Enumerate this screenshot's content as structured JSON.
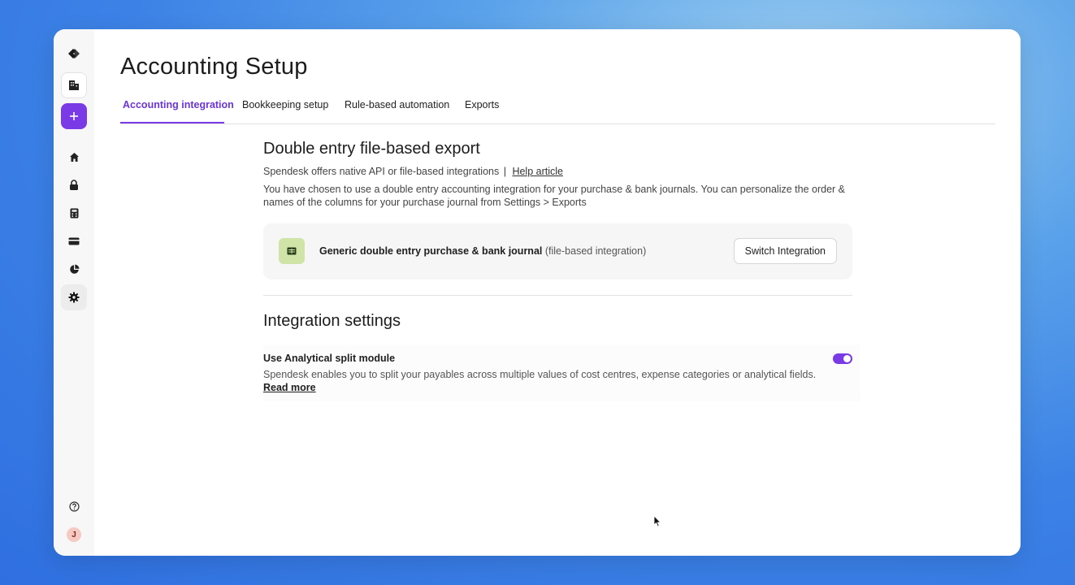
{
  "page": {
    "title": "Accounting Setup"
  },
  "sidebar": {
    "items": [
      {
        "name": "logo",
        "icon": "spendesk-logo-icon"
      },
      {
        "name": "company",
        "icon": "building-icon"
      },
      {
        "name": "new",
        "icon": "plus-icon"
      },
      {
        "name": "home",
        "icon": "home-icon"
      },
      {
        "name": "requests",
        "icon": "lock-icon"
      },
      {
        "name": "payables",
        "icon": "calculator-icon"
      },
      {
        "name": "cards",
        "icon": "card-icon"
      },
      {
        "name": "insights",
        "icon": "pie-chart-icon"
      },
      {
        "name": "settings",
        "icon": "gear-icon"
      },
      {
        "name": "help",
        "icon": "help-icon"
      }
    ],
    "avatar_initial": "J"
  },
  "tabs": [
    {
      "label": "Accounting integration",
      "active": true
    },
    {
      "label": "Bookkeeping setup",
      "active": false
    },
    {
      "label": "Rule-based automation",
      "active": false
    },
    {
      "label": "Exports",
      "active": false
    }
  ],
  "export_section": {
    "heading": "Double entry file-based export",
    "intro": "Spendesk offers native API or file-based integrations",
    "separator": "|",
    "help_link": "Help article",
    "description": "You have chosen to use a double entry accounting integration for your purchase & bank journals. You can personalize the order & names of the columns for your purchase journal from Settings > Exports"
  },
  "integration_card": {
    "icon": "table-icon",
    "label": "Generic double entry purchase & bank journal",
    "note": "(file-based integration)",
    "button": "Switch Integration"
  },
  "settings_section": {
    "heading": "Integration settings",
    "setting_title": "Use Analytical split module",
    "setting_desc": "Spendesk enables you to split your payables across multiple values of cost centres, expense categories or analytical fields.",
    "setting_link": "Read more",
    "toggle_on": true
  },
  "colors": {
    "accent": "#7a3ae6",
    "integration_icon_bg": "#cfe4a6"
  }
}
